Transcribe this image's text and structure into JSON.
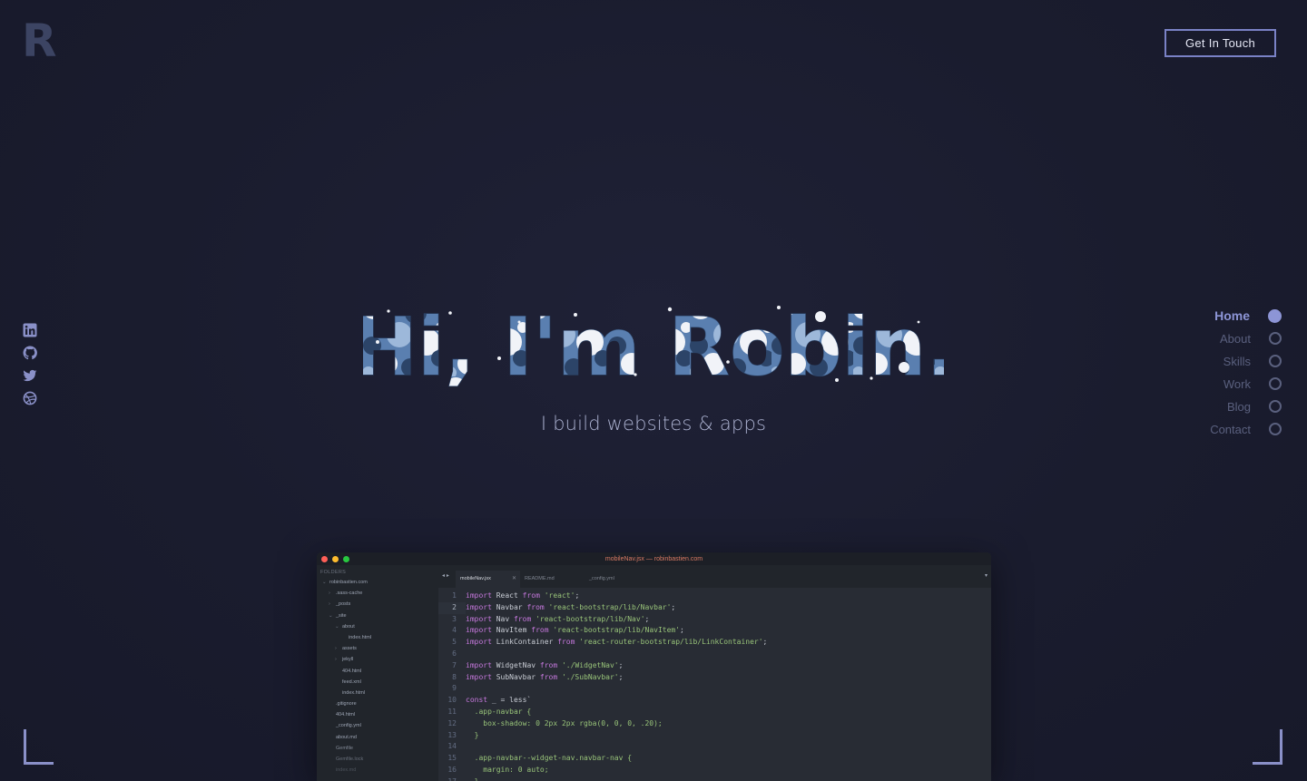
{
  "brand": {
    "logo": "R"
  },
  "header": {
    "cta_label": "Get In Touch"
  },
  "hero": {
    "title": "Hi, I'm Robin.",
    "subtitle": "I build websites & apps"
  },
  "social": [
    "linkedin-icon",
    "github-icon",
    "twitter-icon",
    "dribbble-icon"
  ],
  "nav": {
    "items": [
      {
        "label": "Home",
        "active": true
      },
      {
        "label": "About",
        "active": false
      },
      {
        "label": "Skills",
        "active": false
      },
      {
        "label": "Work",
        "active": false
      },
      {
        "label": "Blog",
        "active": false
      },
      {
        "label": "Contact",
        "active": false
      }
    ]
  },
  "colors": {
    "accent": "#8d95d6",
    "background": "#1a1c2e",
    "camo": [
      "#f1f3f8",
      "#9db8da",
      "#5a7fb0",
      "#2c4468"
    ]
  },
  "editor": {
    "title": "mobileNav.jsx — robinbastien.com",
    "folders_label": "FOLDERS",
    "tree": [
      {
        "name": "robinbastien.com",
        "indent": 0,
        "arrow": "⌄"
      },
      {
        "name": ".sass-cache",
        "indent": 1,
        "arrow": "›"
      },
      {
        "name": "_posts",
        "indent": 1,
        "arrow": "›"
      },
      {
        "name": "_site",
        "indent": 1,
        "arrow": "⌄"
      },
      {
        "name": "about",
        "indent": 2,
        "arrow": "⌄"
      },
      {
        "name": "index.html",
        "indent": 3,
        "arrow": ""
      },
      {
        "name": "assets",
        "indent": 2,
        "arrow": "›"
      },
      {
        "name": "jekyll",
        "indent": 2,
        "arrow": "›"
      },
      {
        "name": "404.html",
        "indent": 2,
        "arrow": ""
      },
      {
        "name": "feed.xml",
        "indent": 2,
        "arrow": ""
      },
      {
        "name": "index.html",
        "indent": 2,
        "arrow": ""
      },
      {
        "name": ".gitignore",
        "indent": 1,
        "arrow": ""
      },
      {
        "name": "404.html",
        "indent": 1,
        "arrow": ""
      },
      {
        "name": "_config.yml",
        "indent": 1,
        "arrow": ""
      },
      {
        "name": "about.md",
        "indent": 1,
        "arrow": ""
      },
      {
        "name": "Gemfile",
        "indent": 1,
        "arrow": ""
      },
      {
        "name": "Gemfile.lock",
        "indent": 1,
        "arrow": ""
      },
      {
        "name": "index.md",
        "indent": 1,
        "arrow": ""
      }
    ],
    "tabs": [
      {
        "label": "mobileNav.jsx",
        "active": true
      },
      {
        "label": "README.md",
        "active": false
      },
      {
        "label": "_config.yml",
        "active": false
      }
    ],
    "code": [
      {
        "n": "1",
        "tokens": [
          [
            "kw",
            "import"
          ],
          [
            "pl",
            " React "
          ],
          [
            "kw",
            "from"
          ],
          [
            "pl",
            " "
          ],
          [
            "st",
            "'react'"
          ],
          [
            "pl",
            ";"
          ]
        ]
      },
      {
        "n": "2",
        "hl": true,
        "tokens": [
          [
            "kw",
            "import"
          ],
          [
            "pl",
            " Navbar "
          ],
          [
            "kw",
            "from"
          ],
          [
            "pl",
            " "
          ],
          [
            "st",
            "'react-bootstrap/lib/Navbar'"
          ],
          [
            "pl",
            ";"
          ]
        ]
      },
      {
        "n": "3",
        "tokens": [
          [
            "kw",
            "import"
          ],
          [
            "pl",
            " Nav "
          ],
          [
            "kw",
            "from"
          ],
          [
            "pl",
            " "
          ],
          [
            "st",
            "'react-bootstrap/lib/Nav'"
          ],
          [
            "pl",
            ";"
          ]
        ]
      },
      {
        "n": "4",
        "tokens": [
          [
            "kw",
            "import"
          ],
          [
            "pl",
            " NavItem "
          ],
          [
            "kw",
            "from"
          ],
          [
            "pl",
            " "
          ],
          [
            "st",
            "'react-bootstrap/lib/NavItem'"
          ],
          [
            "pl",
            ";"
          ]
        ]
      },
      {
        "n": "5",
        "tokens": [
          [
            "kw",
            "import"
          ],
          [
            "pl",
            " LinkContainer "
          ],
          [
            "kw",
            "from"
          ],
          [
            "pl",
            " "
          ],
          [
            "st",
            "'react-router-bootstrap/lib/LinkContainer'"
          ],
          [
            "pl",
            ";"
          ]
        ]
      },
      {
        "n": "6",
        "tokens": []
      },
      {
        "n": "7",
        "tokens": [
          [
            "kw",
            "import"
          ],
          [
            "pl",
            " WidgetNav "
          ],
          [
            "kw",
            "from"
          ],
          [
            "pl",
            " "
          ],
          [
            "st",
            "'./WidgetNav'"
          ],
          [
            "pl",
            ";"
          ]
        ]
      },
      {
        "n": "8",
        "tokens": [
          [
            "kw",
            "import"
          ],
          [
            "pl",
            " SubNavbar "
          ],
          [
            "kw",
            "from"
          ],
          [
            "pl",
            " "
          ],
          [
            "st",
            "'./SubNavbar'"
          ],
          [
            "pl",
            ";"
          ]
        ]
      },
      {
        "n": "9",
        "tokens": []
      },
      {
        "n": "10",
        "tokens": [
          [
            "kw",
            "const"
          ],
          [
            "pl",
            " _ = less`"
          ]
        ]
      },
      {
        "n": "11",
        "tokens": [
          [
            "st",
            "  .app-navbar {"
          ]
        ]
      },
      {
        "n": "12",
        "tokens": [
          [
            "st",
            "    box-shadow: 0 2px 2px rgba(0, 0, 0, .20);"
          ]
        ]
      },
      {
        "n": "13",
        "tokens": [
          [
            "st",
            "  }"
          ]
        ]
      },
      {
        "n": "14",
        "tokens": []
      },
      {
        "n": "15",
        "tokens": [
          [
            "st",
            "  .app-navbar--widget-nav.navbar-nav {"
          ]
        ]
      },
      {
        "n": "16",
        "tokens": [
          [
            "st",
            "    margin: 0 auto;"
          ]
        ]
      },
      {
        "n": "17",
        "tokens": [
          [
            "st",
            "  }"
          ]
        ]
      }
    ]
  }
}
